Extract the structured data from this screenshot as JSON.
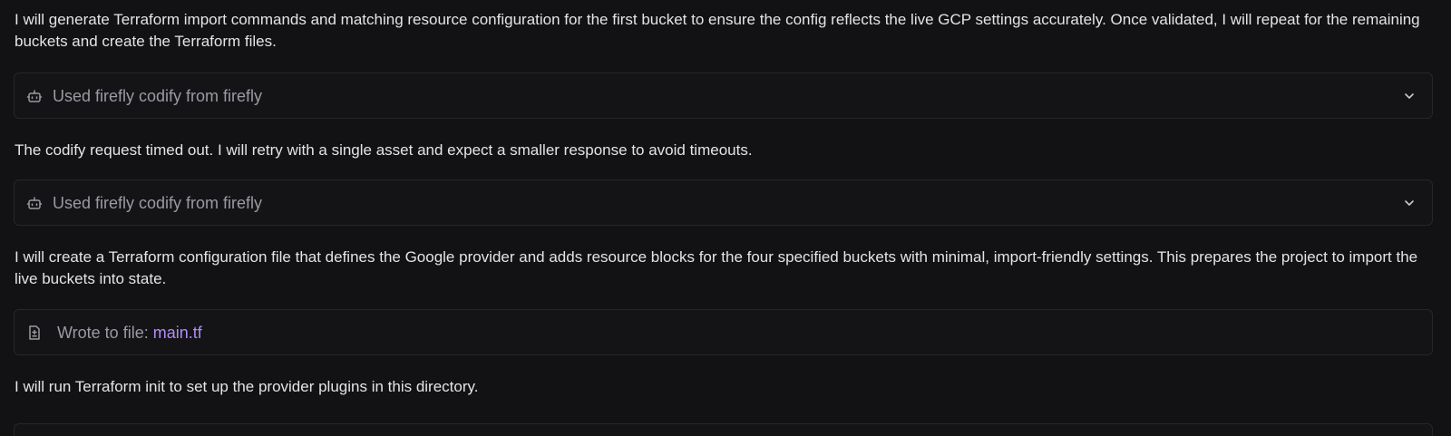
{
  "feed": {
    "para1": "I will generate Terraform import commands and matching resource configuration for the first bucket to ensure the config reflects the live GCP settings accurately. Once validated, I will repeat for the remaining buckets and create the Terraform files.",
    "tool1": {
      "label": "Used firefly codify from firefly",
      "icon": "robot-icon",
      "chevron": "chevron-down-icon"
    },
    "para2": "The codify request timed out. I will retry with a single asset and expect a smaller response to avoid timeouts.",
    "tool2": {
      "label": "Used firefly codify from firefly",
      "icon": "robot-icon",
      "chevron": "chevron-down-icon"
    },
    "para3": "I will create a Terraform configuration file that defines the Google provider and adds resource blocks for the four specified buckets with minimal, import-friendly settings. This prepares the project to import the live buckets into state.",
    "file1": {
      "prefix": "Wrote to file: ",
      "filename": "main.tf",
      "icon": "file-diff-icon",
      "link_color": "#b28cf5"
    },
    "para4": "I will run Terraform init to set up the provider plugins in this directory."
  }
}
